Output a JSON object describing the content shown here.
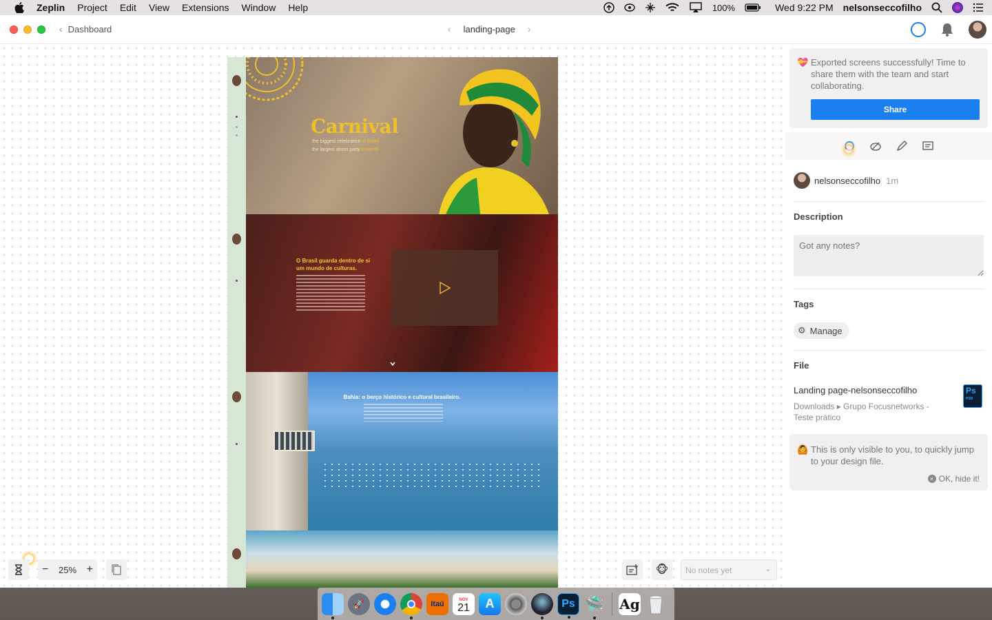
{
  "menubar": {
    "app_name": "Zeplin",
    "items": [
      "Project",
      "Edit",
      "View",
      "Extensions",
      "Window",
      "Help"
    ],
    "battery": "100%",
    "clock": "Wed 9:22 PM",
    "user": "nelsonseccofilho"
  },
  "titlebar": {
    "back_label": "Dashboard",
    "screen_name": "landing-page"
  },
  "artboard": {
    "hero_title": "Carnival",
    "hero_line1_a": "the biggest celebration",
    "hero_line1_b": "in Brasil",
    "hero_line2_a": "the largest street party",
    "hero_line2_b": "in world",
    "brasil_title": "O Brasil guarda dentro de si um mundo de culturas.",
    "bahia_title": "Bahia: o berço histórico e cultural brasileiro."
  },
  "canvas_toolbar": {
    "zoom": "25%",
    "notes_placeholder": "No notes yet"
  },
  "panel": {
    "banner_text": "Exported screens successfully! Time to share them with the team and start collaborating.",
    "share_label": "Share",
    "user_name": "nelsonseccofilho",
    "user_time": "1m",
    "description_heading": "Description",
    "notes_placeholder": "Got any notes?",
    "tags_heading": "Tags",
    "manage_label": "Manage",
    "file_heading": "File",
    "file_name": "Landing page-nelsonseccofilho",
    "file_path": "Downloads ▸ Grupo Focusnetworks - Teste prático",
    "ps_label": "Ps",
    "ps_sub": "PSD",
    "hint_text": "This is only visible to you, to quickly jump to your design file.",
    "hide_label": "OK, hide it!"
  },
  "dock": {
    "itau_label": "Itaú",
    "calendar_month": "NOV",
    "calendar_day": "21",
    "ps_label": "Ps",
    "ag_label": "Ag"
  },
  "colors": {
    "accent": "#1a80f0",
    "carnival_yellow": "#f0c02a"
  }
}
